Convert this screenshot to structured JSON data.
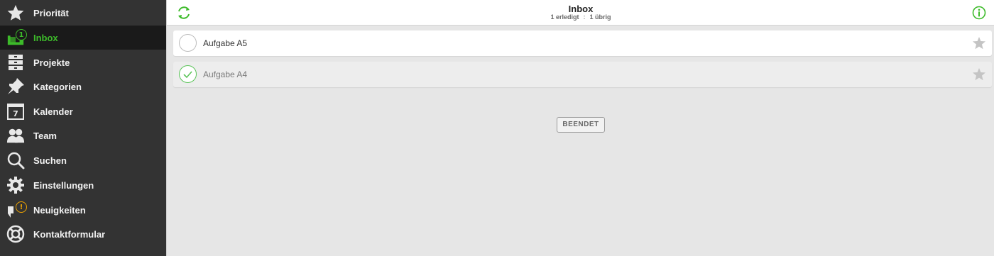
{
  "sidebar": {
    "items": [
      {
        "label": "Priorität",
        "icon": "star-icon"
      },
      {
        "label": "Inbox",
        "icon": "inbox-icon",
        "badge": "1",
        "active": true
      },
      {
        "label": "Projekte",
        "icon": "projects-icon"
      },
      {
        "label": "Kategorien",
        "icon": "pin-icon"
      },
      {
        "label": "Kalender",
        "icon": "calendar-icon",
        "calendar_day": "7"
      },
      {
        "label": "Team",
        "icon": "team-icon"
      },
      {
        "label": "Suchen",
        "icon": "search-icon"
      },
      {
        "label": "Einstellungen",
        "icon": "gear-icon"
      },
      {
        "label": "Neuigkeiten",
        "icon": "news-icon",
        "badge": "!"
      },
      {
        "label": "Kontaktformular",
        "icon": "lifebuoy-icon"
      }
    ]
  },
  "header": {
    "title": "Inbox",
    "done_text": "1 erledigt",
    "separator": ":",
    "remaining_text": "1 übrig"
  },
  "tasks": [
    {
      "title": "Aufgabe A5",
      "completed": false
    },
    {
      "title": "Aufgabe A4",
      "completed": true
    }
  ],
  "finish_button": "BEENDET",
  "colors": {
    "accent": "#3dbb2a",
    "sidebar_bg": "#333333",
    "sidebar_active_bg": "#1a1a1a",
    "news_badge": "#f0a500"
  }
}
